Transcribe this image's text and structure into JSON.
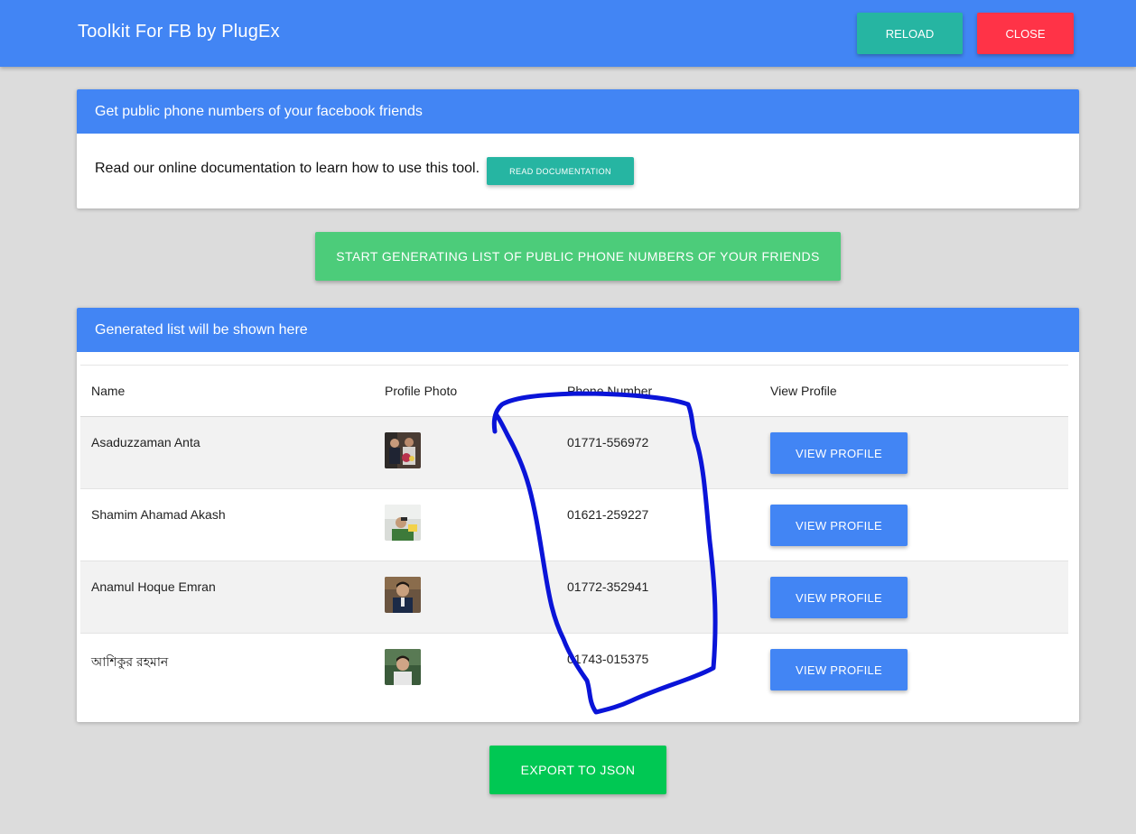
{
  "header": {
    "title": "Toolkit For FB by PlugEx",
    "reload_label": "RELOAD",
    "close_label": "CLOSE",
    "colors": {
      "bar": "#4285f4",
      "reload": "#26b5a2",
      "close": "#ff3347"
    }
  },
  "intro_card": {
    "title": "Get public phone numbers of your facebook friends",
    "text": "Read our online documentation to learn how to use this tool.",
    "docs_button": "READ DOCUMENTATION"
  },
  "start_button": "START GENERATING LIST OF PUBLIC PHONE NUMBERS OF YOUR FRIENDS",
  "results_card": {
    "title": "Generated list will be shown here",
    "columns": [
      "Name",
      "Profile Photo",
      "Phone Number",
      "View Profile"
    ],
    "rows": [
      {
        "name": "Asaduzzaman Anta",
        "phone": "01771-556972",
        "view_label": "VIEW PROFILE",
        "photo_icon": "profile-photo"
      },
      {
        "name": "Shamim Ahamad Akash",
        "phone": "01621-259227",
        "view_label": "VIEW PROFILE",
        "photo_icon": "profile-photo"
      },
      {
        "name": "Anamul Hoque Emran",
        "phone": "01772-352941",
        "view_label": "VIEW PROFILE",
        "photo_icon": "profile-photo"
      },
      {
        "name": "আশিকুর রহমান",
        "phone": "01743-015375",
        "view_label": "VIEW PROFILE",
        "photo_icon": "profile-photo"
      }
    ]
  },
  "export_button": "EXPORT TO JSON",
  "annotation": {
    "color": "#0a14d8",
    "type": "hand-drawn circle around phone numbers"
  }
}
